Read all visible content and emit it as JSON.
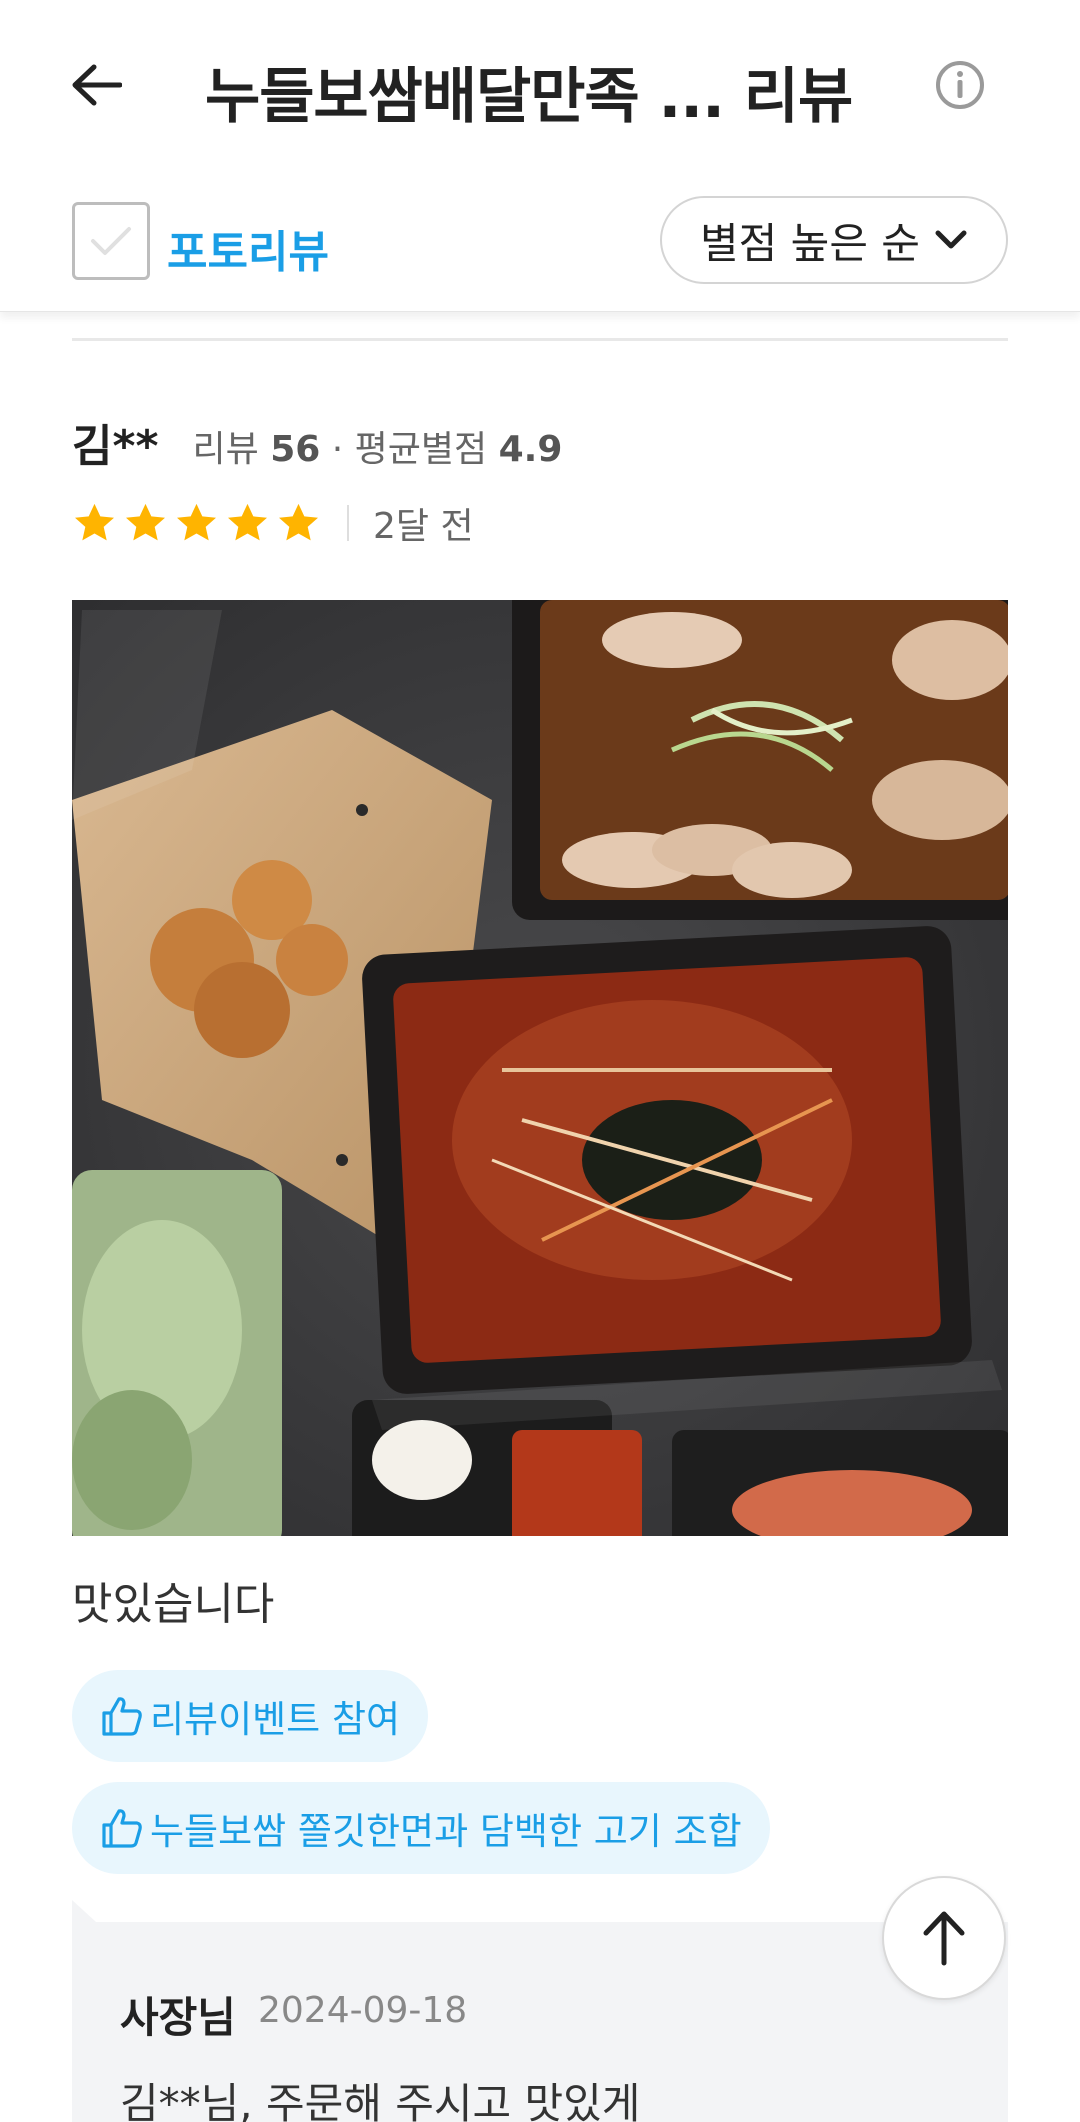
{
  "header": {
    "title": "누들보쌈배달만족 ...  리뷰",
    "back_icon": "arrow-left-icon",
    "info_icon": "info-icon"
  },
  "filter": {
    "photo_review_label": "포토리뷰",
    "photo_review_checked": false,
    "sort_label": "별점 높은 순",
    "accent_color": "#1a9ee6"
  },
  "review": {
    "reviewer_name": "김**",
    "stats_prefix": "리뷰",
    "review_count": "56",
    "stats_dot": "·",
    "avg_label": "평균별점",
    "avg_rating": "4.9",
    "rating": 5,
    "star_color": "#ffb400",
    "date": "2달 전",
    "text": "맛있습니다",
    "tags": [
      {
        "label": "리뷰이벤트  참여",
        "icon": "thumbs-up-icon"
      },
      {
        "label": "누들보쌈 쫄깃한면과 담백한 고기 조합",
        "icon": "thumbs-up-icon"
      }
    ]
  },
  "owner_reply": {
    "name": "사장님",
    "date": "2024-09-18",
    "text": "김**님, 주문해 주시고 맛있게"
  },
  "scroll_top_icon": "arrow-up-icon"
}
